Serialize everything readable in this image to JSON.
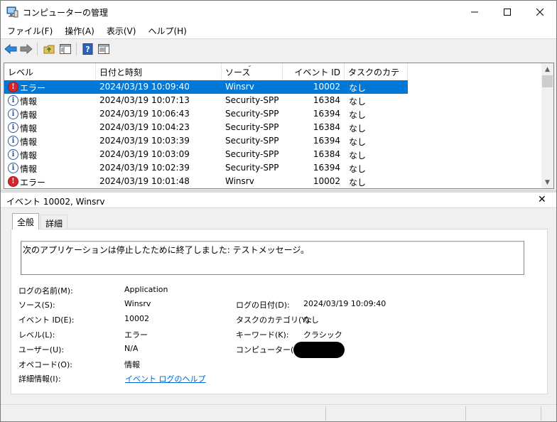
{
  "window": {
    "title": "コンピューターの管理"
  },
  "menu": [
    "ファイル(F)",
    "操作(A)",
    "表示(V)",
    "ヘルプ(H)"
  ],
  "columns": {
    "level": "レベル",
    "date": "日付と時刻",
    "source": "ソース",
    "event_id": "イベント ID",
    "category": "タスクのカテゴリ"
  },
  "events": [
    {
      "level": "エラー",
      "type": "error",
      "date": "2024/03/19 10:09:40",
      "source": "Winsrv",
      "event_id": "10002",
      "category": "なし",
      "selected": true
    },
    {
      "level": "情報",
      "type": "info",
      "date": "2024/03/19 10:07:13",
      "source": "Security-SPP",
      "event_id": "16384",
      "category": "なし"
    },
    {
      "level": "情報",
      "type": "info",
      "date": "2024/03/19 10:06:43",
      "source": "Security-SPP",
      "event_id": "16394",
      "category": "なし"
    },
    {
      "level": "情報",
      "type": "info",
      "date": "2024/03/19 10:04:23",
      "source": "Security-SPP",
      "event_id": "16384",
      "category": "なし"
    },
    {
      "level": "情報",
      "type": "info",
      "date": "2024/03/19 10:03:39",
      "source": "Security-SPP",
      "event_id": "16394",
      "category": "なし"
    },
    {
      "level": "情報",
      "type": "info",
      "date": "2024/03/19 10:03:09",
      "source": "Security-SPP",
      "event_id": "16384",
      "category": "なし"
    },
    {
      "level": "情報",
      "type": "info",
      "date": "2024/03/19 10:02:39",
      "source": "Security-SPP",
      "event_id": "16394",
      "category": "なし"
    },
    {
      "level": "エラー",
      "type": "error",
      "date": "2024/03/19 10:01:48",
      "source": "Winsrv",
      "event_id": "10002",
      "category": "なし"
    }
  ],
  "detail": {
    "title": "イベント 10002, Winsrv",
    "tabs": {
      "general": "全般",
      "details": "詳細"
    },
    "message": "次のアプリケーションは停止したために終了しました: テストメッセージ。",
    "fields": {
      "log_name_label": "ログの名前(M):",
      "log_name": "Application",
      "source_label": "ソース(S):",
      "source": "Winsrv",
      "event_id_label": "イベント ID(E):",
      "event_id": "10002",
      "level_label": "レベル(L):",
      "level": "エラー",
      "user_label": "ユーザー(U):",
      "user": "N/A",
      "opcode_label": "オペコード(O):",
      "opcode": "情報",
      "more_info_label": "詳細情報(I):",
      "more_info_link": "イベント ログのヘルプ",
      "logged_label": "ログの日付(D):",
      "logged": "2024/03/19 10:09:40",
      "category_label": "タスクのカテゴリ(Y):",
      "category": "なし",
      "keywords_label": "キーワード(K):",
      "keywords": "クラシック",
      "computer_label": "コンピューター(R):"
    }
  },
  "colors": {
    "selection": "#0078d7",
    "link": "#0066cc",
    "error": "#d8262c",
    "info": "#2b579a"
  }
}
